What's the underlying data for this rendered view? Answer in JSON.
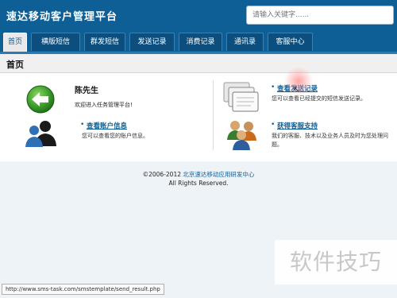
{
  "header": {
    "title": "速达移动客户管理平台",
    "search_placeholder": "请输入关键字......"
  },
  "nav": {
    "tabs": [
      "首页",
      "横版短信",
      "群发短信",
      "发送记录",
      "消费记录",
      "通讯录",
      "客服中心"
    ],
    "active": "首页"
  },
  "page": {
    "title": "首页"
  },
  "welcome": {
    "name": "陈先生",
    "message": "欢迎进入任务管理平台!"
  },
  "panels": {
    "send_records": {
      "bullet": "•",
      "link": "查看发送记录",
      "desc": "您可以查看已经提交的短信发送记录。"
    },
    "account_info": {
      "bullet": "•",
      "link": "查看账户信息",
      "desc": "您可以查看您的账户信息。"
    },
    "support": {
      "bullet": "•",
      "link": "获得客服支持",
      "desc_line1": "我们的客服、技术以及业务人员及时为您处理问",
      "desc_line2": "题。"
    }
  },
  "footer": {
    "copyright": "©2006-2012 ",
    "org": "北京速达移动应用研发中心",
    "rights": "All Rights Reserved."
  },
  "status_bar": {
    "url": "http://www.sms-task.com/smstemplate/send_result.php"
  },
  "watermark": {
    "text": "软件技巧"
  },
  "colors": {
    "header_blue": "#0e5f95",
    "link_blue": "#0e5f95",
    "footer_bg": "#eef3f8"
  },
  "icons": [
    "back-arrow-icon",
    "user-account-icon",
    "documents-icon",
    "support-team-icon",
    "cursor-icon"
  ]
}
